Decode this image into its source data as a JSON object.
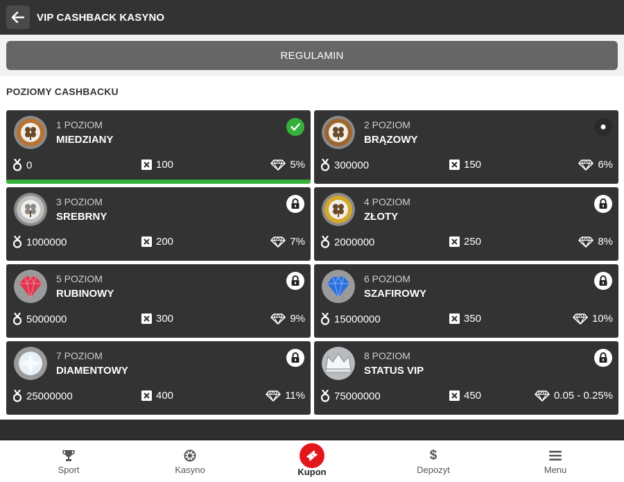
{
  "header": {
    "title": "VIP CASHBACK KASYNO",
    "back_icon": "arrow-left-icon"
  },
  "regulamin_label": "REGULAMIN",
  "section_title": "POZIOMY CASHBACKU",
  "levels": [
    {
      "level": "1 POZIOM",
      "name": "MIEDZIANY",
      "points": "0",
      "multiplier": "100",
      "cashback": "5%",
      "status": "completed",
      "badge_color": "#b87333"
    },
    {
      "level": "2 POZIOM",
      "name": "BRĄZOWY",
      "points": "300000",
      "multiplier": "150",
      "cashback": "6%",
      "status": "current",
      "badge_color": "#a0652e"
    },
    {
      "level": "3 POZIOM",
      "name": "SREBRNY",
      "points": "1000000",
      "multiplier": "200",
      "cashback": "7%",
      "status": "locked",
      "badge_color": "#bfbfbf"
    },
    {
      "level": "4 POZIOM",
      "name": "ZŁOTY",
      "points": "2000000",
      "multiplier": "250",
      "cashback": "8%",
      "status": "locked",
      "badge_color": "#d4a82a"
    },
    {
      "level": "5 POZIOM",
      "name": "RUBINOWY",
      "points": "5000000",
      "multiplier": "300",
      "cashback": "9%",
      "status": "locked",
      "badge_color": "#e2334f"
    },
    {
      "level": "6 POZIOM",
      "name": "SZAFIROWY",
      "points": "15000000",
      "multiplier": "350",
      "cashback": "10%",
      "status": "locked",
      "badge_color": "#2a6fe0"
    },
    {
      "level": "7 POZIOM",
      "name": "DIAMENTOWY",
      "points": "25000000",
      "multiplier": "400",
      "cashback": "11%",
      "status": "locked",
      "badge_color": "#e6f0f7"
    },
    {
      "level": "8 POZIOM",
      "name": "STATUS VIP",
      "points": "75000000",
      "multiplier": "450",
      "cashback": "0.05 - 0.25%",
      "status": "locked",
      "badge_color": "#c9cdd2"
    }
  ],
  "bottom_nav": [
    {
      "label": "Sport",
      "icon": "trophy-icon"
    },
    {
      "label": "Kasyno",
      "icon": "roulette-icon"
    },
    {
      "label": "Kupon",
      "icon": "ticket-icon",
      "active": true
    },
    {
      "label": "Depozyt",
      "icon": "dollar-icon"
    },
    {
      "label": "Menu",
      "icon": "hamburger-icon"
    }
  ],
  "colors": {
    "header": "#333333",
    "card": "#333333",
    "accent_green": "#35b13b",
    "kupon_red": "#e3161b"
  }
}
